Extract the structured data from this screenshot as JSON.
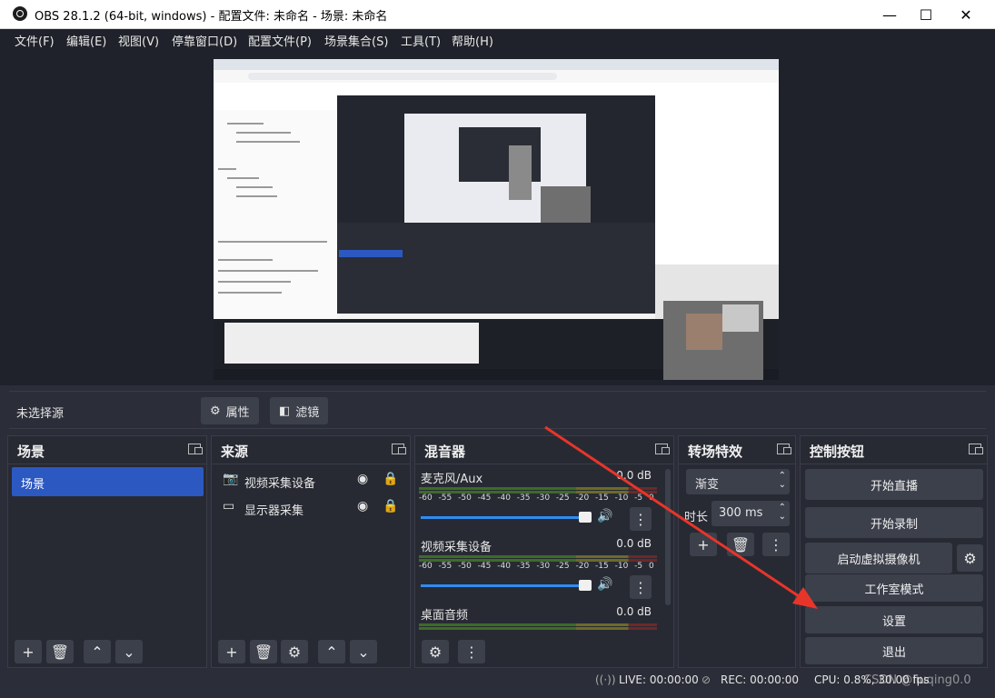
{
  "window": {
    "title": "OBS 28.1.2 (64-bit, windows) - 配置文件: 未命名 - 场景: 未命名",
    "minimize": "—",
    "maximize": "☐",
    "close": "✕"
  },
  "menu": [
    "文件(F)",
    "编辑(E)",
    "视图(V)",
    "停靠窗口(D)",
    "配置文件(P)",
    "场景集合(S)",
    "工具(T)",
    "帮助(H)"
  ],
  "source_toolbar": {
    "no_source": "未选择源",
    "properties": "属性",
    "filters": "滤镜"
  },
  "scenes": {
    "title": "场景",
    "items": [
      "场景"
    ]
  },
  "sources": {
    "title": "来源",
    "items": [
      "视频采集设备",
      "显示器采集"
    ]
  },
  "mixer": {
    "title": "混音器",
    "channels": [
      {
        "name": "麦克风/Aux",
        "level": "0.0 dB"
      },
      {
        "name": "视频采集设备",
        "level": "0.0 dB"
      },
      {
        "name": "桌面音频",
        "level": "0.0 dB"
      }
    ],
    "ticks": "-60 -55 -50 -45 -40 -35 -30 -25 -20 -15 -10 -5 0"
  },
  "transitions": {
    "title": "转场特效",
    "type": "渐变",
    "duration_label": "时长",
    "duration_value": "300 ms"
  },
  "controls": {
    "title": "控制按钮",
    "start_streaming": "开始直播",
    "start_recording": "开始录制",
    "start_virtual_cam": "启动虚拟摄像机",
    "studio_mode": "工作室模式",
    "settings": "设置",
    "exit": "退出"
  },
  "status": {
    "live": "LIVE: 00:00:00",
    "rec": "REC: 00:00:00",
    "cpu": "CPU: 0.8%, 30.00 fps",
    "watermark": "CSDN @liuqing0.0"
  },
  "colors": {
    "panel_bg": "#272a33",
    "button_bg": "#3c404b",
    "selected_scene": "#2c58c2",
    "meter_green": "#58a83a",
    "meter_yellow": "#b4a83a",
    "meter_red": "#b43a3a",
    "slider_blue": "#2f8cf0",
    "arrow_red": "#e8352a"
  }
}
